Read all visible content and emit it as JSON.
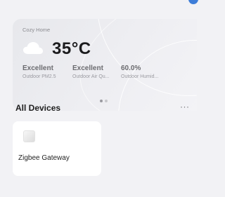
{
  "weather": {
    "home_name": "Cozy Home",
    "temperature": "35°C",
    "condition_icon": "cloud-icon",
    "metrics": [
      {
        "value": "Excellent",
        "label": "Outdoor PM2.5"
      },
      {
        "value": "Excellent",
        "label": "Outdoor Air Qu..."
      },
      {
        "value": "60.0%",
        "label": "Outdoor Humid..."
      }
    ],
    "pagination": {
      "total": 2,
      "active": 1
    }
  },
  "devices": {
    "section_title": "All Devices",
    "more_label": "···",
    "items": [
      {
        "name": "Zigbee Gateway",
        "icon": "gateway-icon"
      }
    ]
  },
  "colors": {
    "background": "#f2f2f5",
    "card": "#ffffff",
    "accent": "#3d7dd8"
  }
}
